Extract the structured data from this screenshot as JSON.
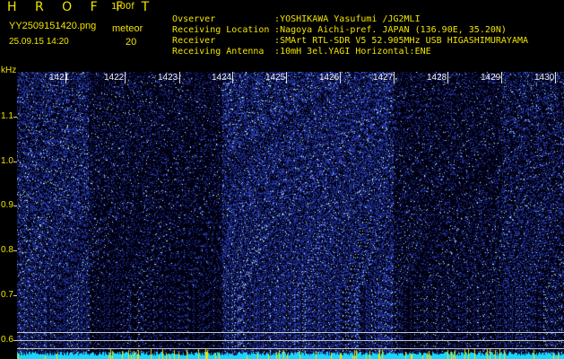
{
  "header": {
    "app_title": "H R O F F T",
    "version": "1.00f",
    "file_name": "YY2509151420.png",
    "date_time": "25.09.15 14:20",
    "mode_label": "meteor",
    "count_value": "20"
  },
  "info": [
    {
      "key": "Ovserver",
      "value": ":YOSHIKAWA Yasufumi /JG2MLI"
    },
    {
      "key": "Receiving Location",
      "value": ":Nagoya Aichi-pref. JAPAN (136.90E, 35.20N)"
    },
    {
      "key": "Receiver",
      "value": ":SMArt RTL-SDR V5 52.905MHz USB HIGASHIMURAYAMA"
    },
    {
      "key": "Receiving Antenna",
      "value": ":10mH 3el.YAGI Horizontal:ENE"
    }
  ],
  "axis": {
    "y_unit": "kHz",
    "y_ticks": [
      "1.1",
      "1.0",
      "0.9",
      "0.8",
      "0.7",
      "0.6"
    ],
    "x_ticks": [
      "1421",
      "1422",
      "1423",
      "1424",
      "1425",
      "1426",
      "1427",
      "1428",
      "1429",
      "1430"
    ]
  },
  "colors": {
    "text_yellow": "#f0e400",
    "background": "#000000",
    "signal_cyan": "#20e0ff",
    "noise_blue": "#2a3ad0"
  }
}
